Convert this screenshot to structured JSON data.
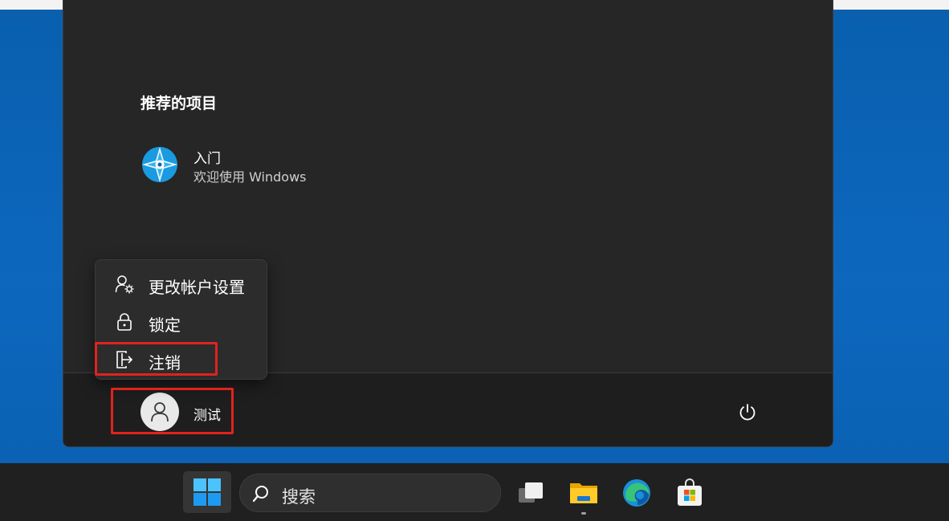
{
  "start_menu": {
    "recommended_title": "推荐的项目",
    "recommended_items": [
      {
        "name": "入门",
        "subtitle": "欢迎使用 Windows",
        "icon": "get-started-icon"
      }
    ]
  },
  "account_flyout": {
    "items": [
      {
        "label": "更改帐户设置",
        "icon": "account-settings-icon"
      },
      {
        "label": "锁定",
        "icon": "lock-icon"
      },
      {
        "label": "注销",
        "icon": "sign-out-icon"
      }
    ]
  },
  "user": {
    "name": "测试",
    "icon": "user-avatar-icon"
  },
  "power": {
    "icon": "power-icon"
  },
  "taskbar": {
    "search_placeholder": "搜索",
    "apps": [
      {
        "name": "task-view",
        "icon": "task-view-icon"
      },
      {
        "name": "file-explorer",
        "icon": "folder-icon"
      },
      {
        "name": "edge",
        "icon": "edge-icon"
      },
      {
        "name": "store",
        "icon": "store-icon"
      }
    ]
  },
  "colors": {
    "highlight": "#e0231d",
    "menu_bg": "#262626",
    "wallpaper": "#0a63b5",
    "taskbar_bg": "#202020"
  }
}
